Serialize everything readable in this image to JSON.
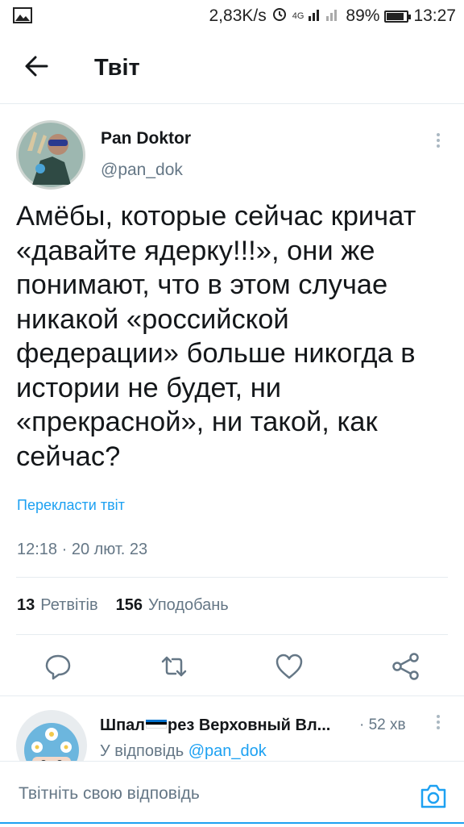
{
  "statusbar": {
    "speed": "2,83K/s",
    "network": "4G",
    "battery": "89%",
    "battery_level": 0.89,
    "time": "13:27"
  },
  "header": {
    "title": "Твіт"
  },
  "tweet": {
    "author_name": "Pan Doktor",
    "author_handle": "@pan_dok",
    "text": "Амёбы, которые сейчас кричат\n«давайте ядерку!!!», они же\nпонимают, что в этом случае\nникакой «российской\nфедерации» больше никогда в\nистории не будет, ни\n«прекрасной», ни такой, как\nсейчас?",
    "translate_label": "Перекласти твіт",
    "timestamp": "12:18 · 20 лют. 23",
    "retweets_count": "13",
    "retweets_label": "Ретвітів",
    "likes_count": "156",
    "likes_label": "Уподобань"
  },
  "reply": {
    "name_part1": "Шпал",
    "name_part2": "рез Верховный Вл...",
    "time": "· 52 хв",
    "reply_to_label": "У відповідь",
    "reply_to_handle": "@pan_dok"
  },
  "composer": {
    "placeholder": "Твітніть свою відповідь"
  },
  "colors": {
    "accent": "#1da1f2",
    "secondary_text": "#657786",
    "divider": "#e6ecf0"
  },
  "icons": [
    "image-icon",
    "alarm-icon",
    "back-arrow-icon",
    "more-icon",
    "reply-icon",
    "retweet-icon",
    "like-icon",
    "share-icon",
    "camera-icon",
    "estonia-flag-icon"
  ]
}
